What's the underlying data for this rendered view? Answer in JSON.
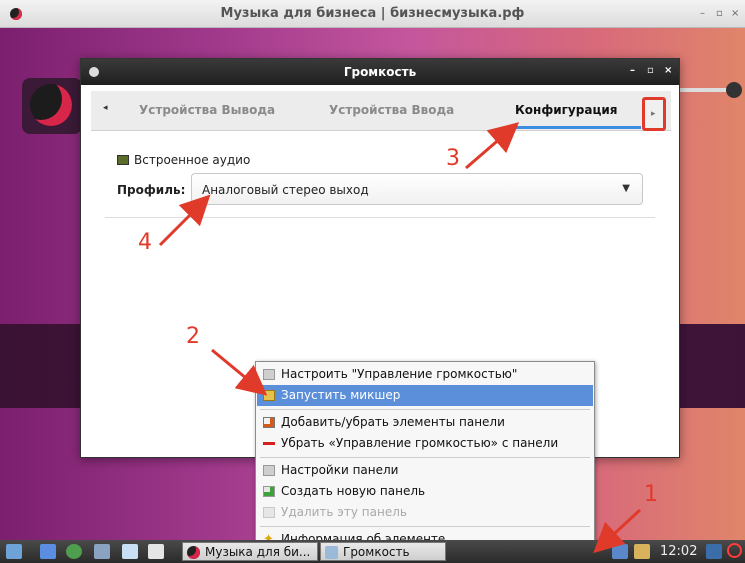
{
  "outer_window": {
    "title": "Музыка для бизнеса | бизнесмузыка.рф",
    "controls": [
      "–",
      "▫",
      "×"
    ]
  },
  "dialog": {
    "title": "Громкость",
    "controls": [
      "–",
      "▫",
      "×"
    ],
    "tabs": [
      {
        "label": "Устройства Вывода",
        "active": false
      },
      {
        "label": "Устройства Ввода",
        "active": false
      },
      {
        "label": "Конфигурация",
        "active": true
      }
    ],
    "tab_prev": "◂",
    "tab_next": "▸",
    "device_name": "Встроенное аудио",
    "profile_label": "Профиль:",
    "profile_value": "Аналоговый стерео выход"
  },
  "context_menu": {
    "items": [
      {
        "label": "Настроить \"Управление громкостью\"",
        "icon": "settings-icon",
        "state": "normal"
      },
      {
        "label": "Запустить микшер",
        "icon": "mixer-icon",
        "state": "selected"
      },
      {
        "label": "Добавить/убрать элементы панели",
        "icon": "edit-icon",
        "state": "normal"
      },
      {
        "label": "Убрать «Управление громкостью» с панели",
        "icon": "remove-icon",
        "state": "normal"
      },
      {
        "label": "Настройки панели",
        "icon": "panel-settings-icon",
        "state": "normal"
      },
      {
        "label": "Создать новую панель",
        "icon": "new-panel-icon",
        "state": "normal"
      },
      {
        "label": "Удалить эту панель",
        "icon": "delete-panel-icon",
        "state": "disabled"
      },
      {
        "label": "Информация об элементе",
        "icon": "info-icon",
        "state": "normal"
      }
    ]
  },
  "taskbar": {
    "tasks": [
      {
        "label": "Музыка для би..."
      },
      {
        "label": "Громкость"
      }
    ],
    "clock": "12:02"
  },
  "annotations": {
    "numbers": [
      "1",
      "2",
      "3",
      "4"
    ],
    "color": "#e03a2a"
  },
  "colors": {
    "menu_selection": "#5b8fd9",
    "tab_underline": "#3d8ee0",
    "annotation_red": "#e03a2a"
  }
}
